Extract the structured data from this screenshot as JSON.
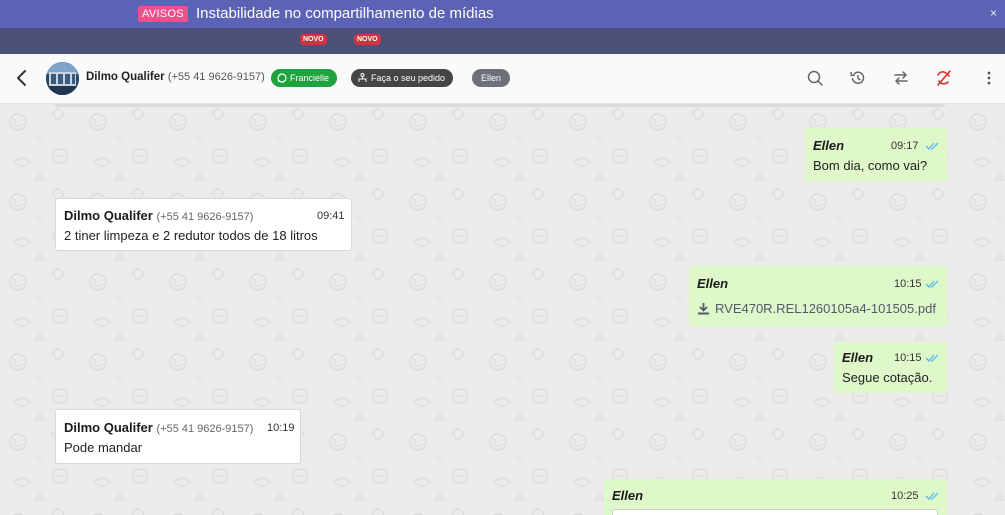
{
  "notice": {
    "tag": "AVISOS",
    "text": "Instabilidade no compartilhamento de mídias",
    "close": "×"
  },
  "nav": {
    "badges": [
      "NOVO",
      "NOVO"
    ]
  },
  "header": {
    "contact_name": "Dilmo Qualifer",
    "contact_phone": "(+55 41 9626-9157)",
    "pills": {
      "channel": "Francielle",
      "flow": "Faça o seu pedido",
      "agent": "Ellen"
    },
    "icons": [
      "search-icon",
      "history-icon",
      "transfer-icon",
      "finish-icon",
      "more-icon"
    ]
  },
  "colors": {
    "notice_bg": "#5c63b4",
    "outgoing_bubble": "#dff8c9",
    "read_ticks": "#53bdeb",
    "whatsapp_green": "#1fa33f"
  },
  "messages": [
    {
      "direction": "out",
      "author": "Ellen",
      "time": "09:17",
      "text": "Bom dia, como vai?"
    },
    {
      "direction": "in",
      "author": "Dilmo Qualifer",
      "phone": "(+55 41 9626-9157)",
      "time": "09:41",
      "text": "2 tiner limpeza e 2 redutor todos de 18 litros"
    },
    {
      "direction": "out",
      "author": "Ellen",
      "time": "10:15",
      "file": "RVE470R.REL1260105a4-101505.pdf"
    },
    {
      "direction": "out",
      "author": "Ellen",
      "time": "10:15",
      "text": "Segue cotação."
    },
    {
      "direction": "in",
      "author": "Dilmo Qualifer",
      "phone": "(+55 41 9626-9157)",
      "time": "10:19",
      "text": "Pode mandar"
    },
    {
      "direction": "out",
      "author": "Ellen",
      "time": "10:25"
    }
  ]
}
